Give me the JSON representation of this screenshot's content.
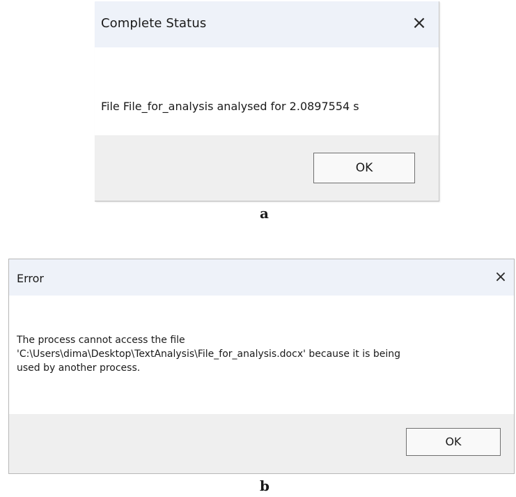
{
  "dialog_a": {
    "title": "Complete Status",
    "close_icon": "×",
    "message": "File File_for_analysis analysed for 2.0897554 s",
    "ok_label": "OK"
  },
  "caption_a": "a",
  "dialog_b": {
    "title": "Error",
    "close_icon": "×",
    "message_lines": [
      "The process cannot access the file",
      "'C:\\Users\\dima\\Desktop\\TextAnalysis\\File_for_analysis.docx' because it is being",
      "used by another process."
    ],
    "ok_label": "OK"
  },
  "caption_b": "b",
  "colors": {
    "titlebar": "#eef2f9",
    "footer": "#efefef",
    "button_border": "#6f6f6f"
  }
}
